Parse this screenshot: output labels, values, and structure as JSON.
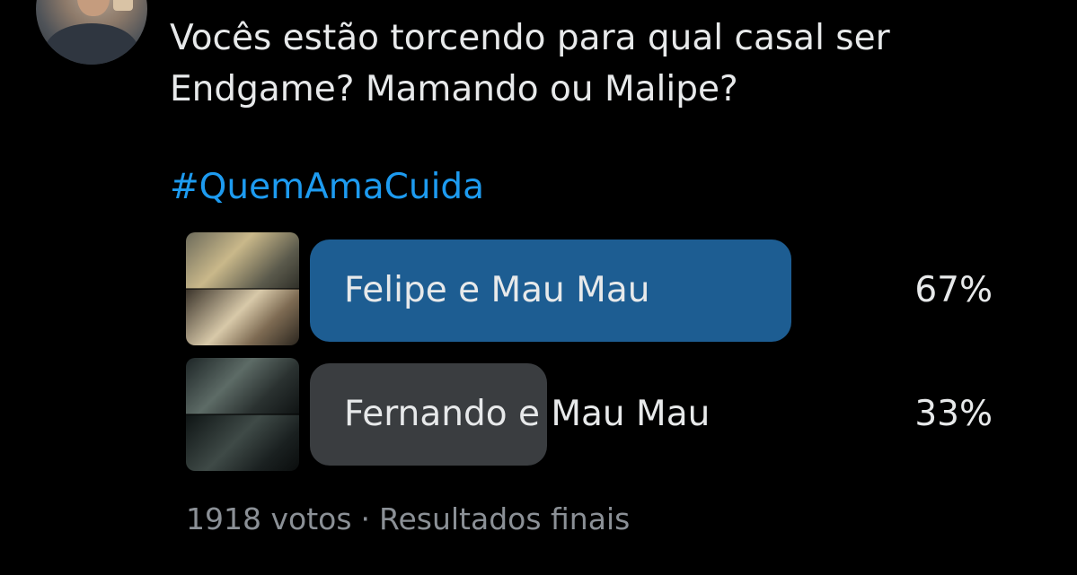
{
  "tweet": {
    "text": "Vocês estão torcendo para qual casal ser Endgame? Mamando ou Malipe?",
    "hashtag": "#QuemAmaCuida"
  },
  "poll": {
    "options": [
      {
        "label": "Felipe e Mau Mau",
        "percent_text": "67%",
        "fraction": 0.67,
        "bar_color": "#1d5d92"
      },
      {
        "label": "Fernando e Mau Mau",
        "percent_text": "33%",
        "fraction": 0.33,
        "bar_color": "#3a3d40"
      }
    ],
    "votes_text": "1918 votos",
    "separator": "·",
    "status_text": "Resultados finais"
  },
  "colors": {
    "background": "#000000",
    "text": "#e7e9ea",
    "link": "#1d9bf0",
    "muted": "#8b9096"
  }
}
